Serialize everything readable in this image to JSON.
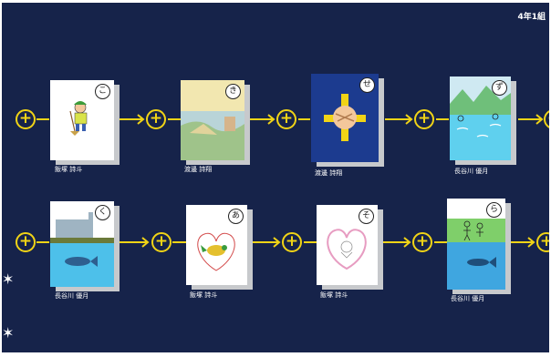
{
  "header": {
    "class_label": "4年1組"
  },
  "cards": [
    {
      "kana": "こ",
      "author": "飯塚 詩斗",
      "picture": "person-with-broom"
    },
    {
      "kana": "き",
      "author": "渡邊 詩翔",
      "picture": "landscape-scene"
    },
    {
      "kana": "せ",
      "author": "渡邊 詩翔",
      "picture": "hands-cross"
    },
    {
      "kana": "ず",
      "author": "長谷川 優月",
      "picture": "mountain-river"
    },
    {
      "kana": "く",
      "author": "長谷川 優月",
      "picture": "whale-factory"
    },
    {
      "kana": "あ",
      "author": "飯塚 詩斗",
      "picture": "bird-heart"
    },
    {
      "kana": "そ",
      "author": "飯塚 詩斗",
      "picture": "hands-heart"
    },
    {
      "kana": "ら",
      "author": "長谷川 優月",
      "picture": "people-fish"
    }
  ],
  "controls": {
    "add_symbol": "+",
    "side_arrow_symbol": "✶"
  },
  "colors": {
    "board": "#16234a",
    "accent": "#f1d416",
    "card": "#ffffff"
  }
}
